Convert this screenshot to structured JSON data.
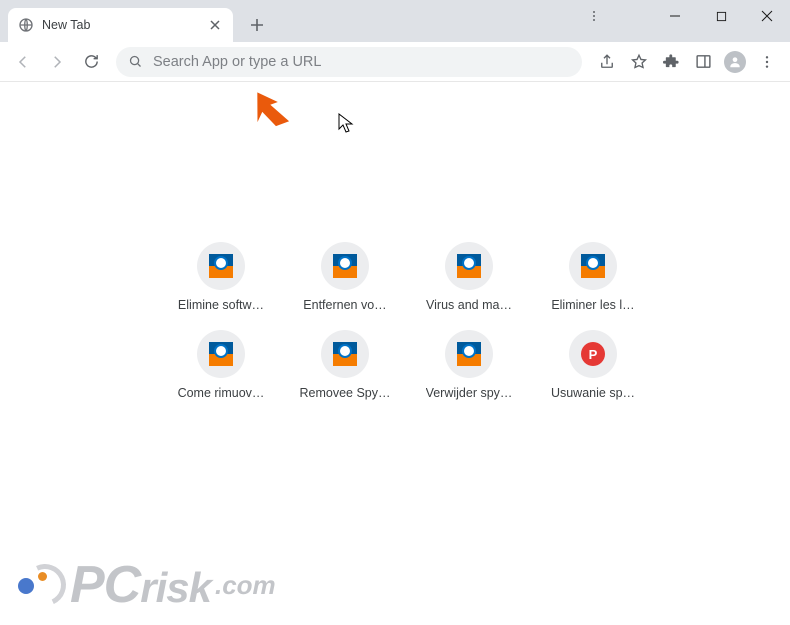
{
  "tab": {
    "title": "New Tab"
  },
  "omnibox": {
    "placeholder": "Search App or type a URL",
    "value": ""
  },
  "shortcuts": [
    {
      "label": "Elimine softw…",
      "icon": "pcrisk"
    },
    {
      "label": "Entfernen vo…",
      "icon": "pcrisk"
    },
    {
      "label": "Virus and ma…",
      "icon": "pcrisk"
    },
    {
      "label": "Eliminer les l…",
      "icon": "pcrisk"
    },
    {
      "label": "Come rimuov…",
      "icon": "pcrisk"
    },
    {
      "label": "Removee Spy…",
      "icon": "pcrisk"
    },
    {
      "label": "Verwijder spy…",
      "icon": "pcrisk"
    },
    {
      "label": "Usuwanie sp…",
      "icon": "p-red"
    }
  ],
  "watermark": {
    "brand_prefix": "PC",
    "brand_suffix": "risk",
    "tld": ".com"
  },
  "colors": {
    "chrome_bg": "#dee1e6",
    "omnibox_bg": "#f1f3f4",
    "arrow": "#ea5a0c"
  }
}
